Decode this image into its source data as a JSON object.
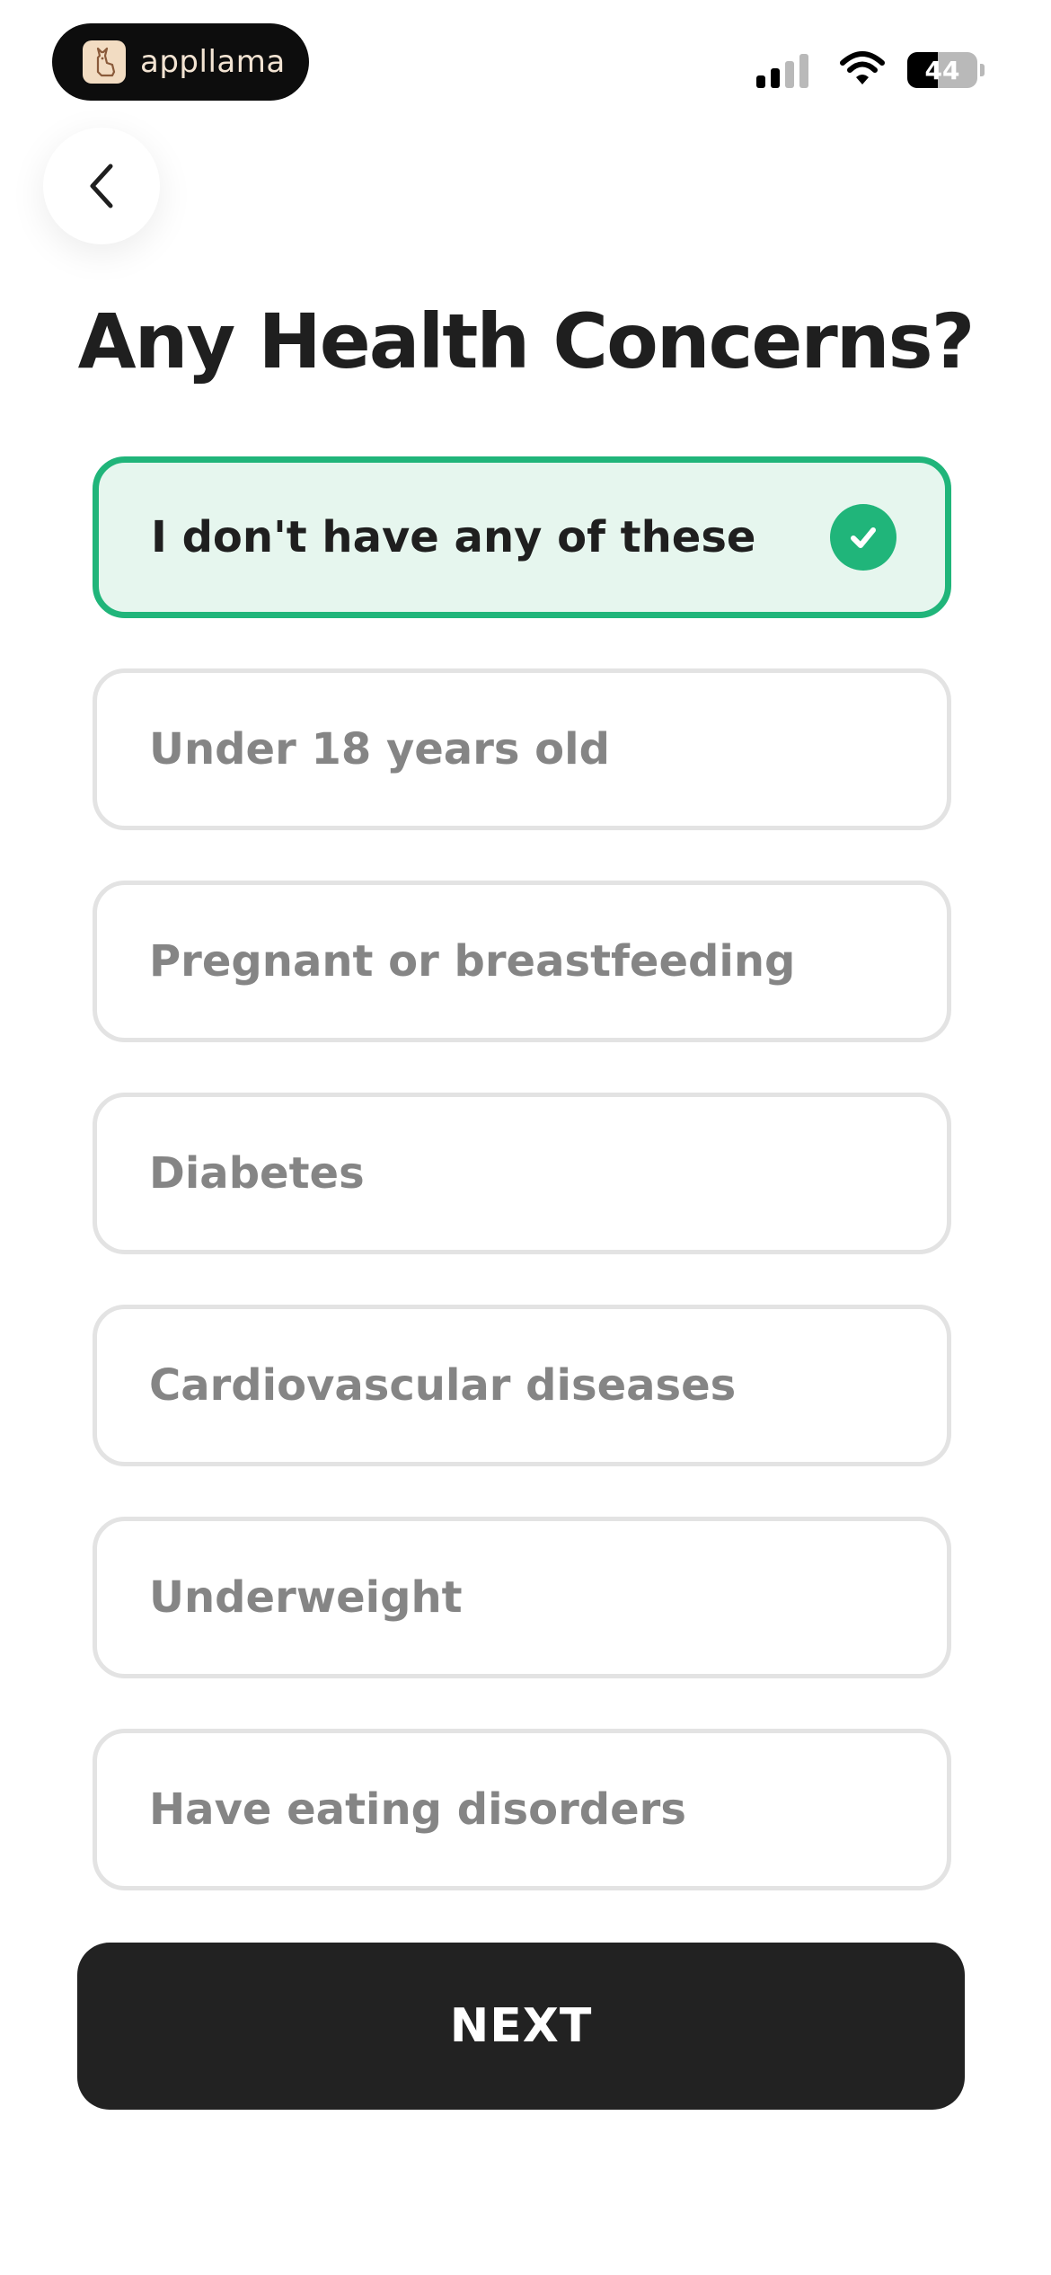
{
  "status_bar": {
    "brand_name": "appllama",
    "battery_level": "44",
    "battery_fraction": 0.44,
    "signal_bars_active": 2,
    "signal_bars_total": 4
  },
  "icons": {
    "back": "chevron-left-icon",
    "check": "check-circle-icon",
    "wifi": "wifi-icon",
    "signal": "cellular-signal-icon",
    "battery": "battery-icon",
    "brand": "llama-logo-icon"
  },
  "page": {
    "title": "Any Health Concerns?"
  },
  "options": [
    {
      "label": "I don't have any of these",
      "selected": true
    },
    {
      "label": "Under 18 years old",
      "selected": false
    },
    {
      "label": "Pregnant or breastfeeding",
      "selected": false
    },
    {
      "label": "Diabetes",
      "selected": false
    },
    {
      "label": "Cardiovascular diseases",
      "selected": false
    },
    {
      "label": "Underweight",
      "selected": false
    },
    {
      "label": "Have eating disorders",
      "selected": false
    }
  ],
  "actions": {
    "next_label": "NEXT"
  },
  "colors": {
    "accent": "#20b57a",
    "selected_bg": "#e6f6ee",
    "button_bg": "#222222",
    "unselected_text": "#858585",
    "border": "#e3e3e3"
  }
}
